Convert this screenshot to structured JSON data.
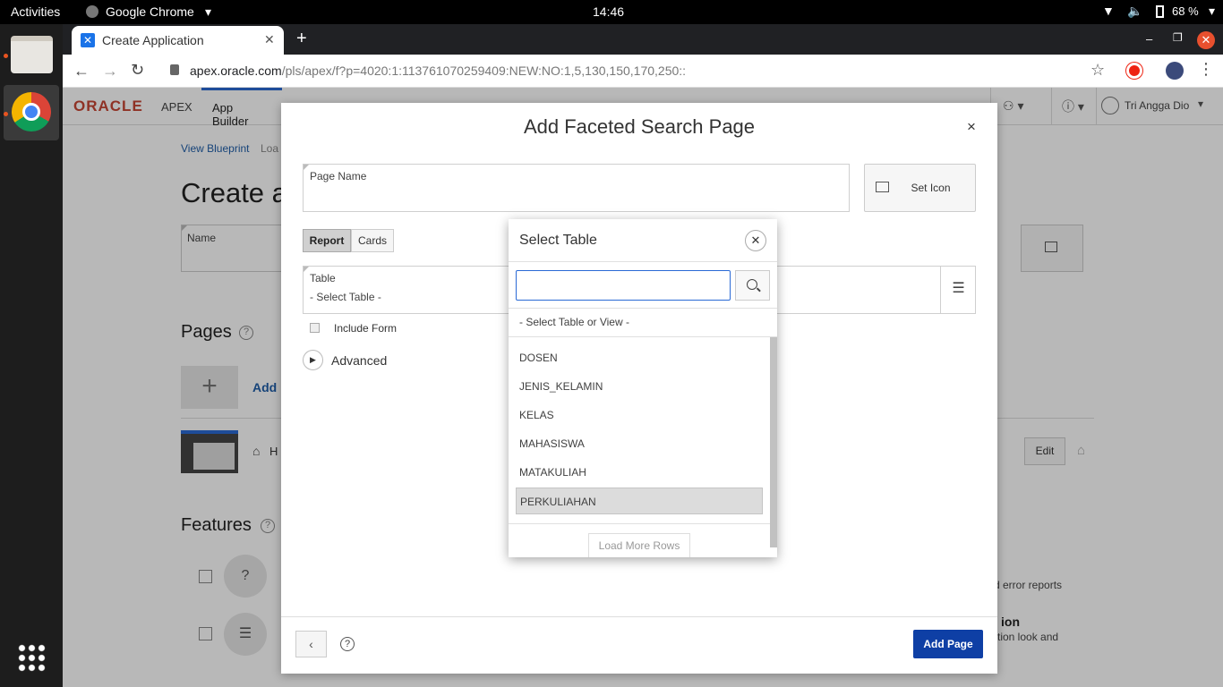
{
  "os": {
    "activities": "Activities",
    "app_name": "Google Chrome",
    "clock": "14:46",
    "battery": "68 %"
  },
  "browser": {
    "tab_title": "Create Application",
    "url_domain": "apex.oracle.com",
    "url_path": "/pls/apex/f?p=4020:1:113761070259409:NEW:NO:1,5,130,150,170,250::"
  },
  "apex": {
    "logo_oracle": "ORACLE",
    "logo_apex": "APEX",
    "nav_app_builder": "App Builder",
    "user_name": "Tri Angga Dio"
  },
  "background": {
    "breadcrumb": "View Blueprint",
    "breadcrumb_rest": "Loa",
    "heading": "Create a",
    "name_label": "Name",
    "pages_title": "Pages",
    "add_label": "Add",
    "home_label": "H",
    "edit_button": "Edit",
    "features_title": "Features",
    "feature1_text": "d error reports",
    "feature2_title": "ion",
    "feature2_text": "tion look and"
  },
  "dialog": {
    "title": "Add Faceted Search Page",
    "page_name_label": "Page Name",
    "set_icon": "Set Icon",
    "tab_report": "Report",
    "tab_cards": "Cards",
    "table_label": "Table",
    "table_value": "- Select Table -",
    "include_form": "Include Form",
    "advanced": "Advanced",
    "add_page": "Add Page"
  },
  "select_table": {
    "title": "Select Table",
    "search_value": "",
    "null_option": "- Select Table or View -",
    "items": [
      "DOSEN",
      "JENIS_KELAMIN",
      "KELAS",
      "MAHASISWA",
      "MATAKULIAH",
      "PERKULIAHAN"
    ],
    "load_more": "Load More Rows"
  },
  "colors": {
    "primary_button": "#0e3fa5",
    "oracle_red": "#c74634",
    "close_red": "#e8502e"
  }
}
